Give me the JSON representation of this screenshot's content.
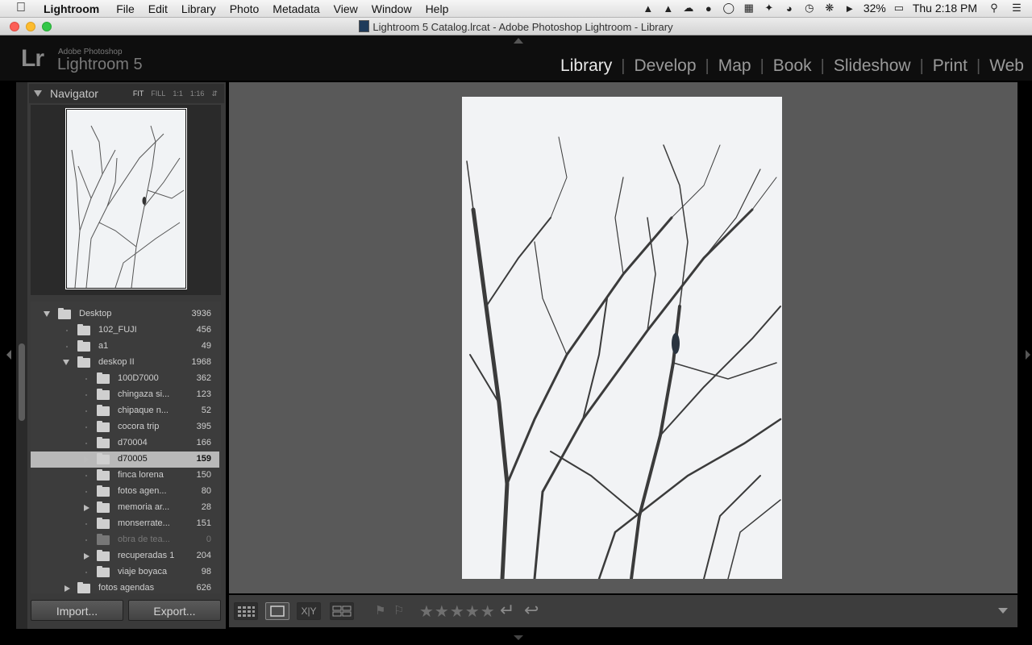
{
  "menubar": {
    "apple": "",
    "items": [
      "Lightroom",
      "File",
      "Edit",
      "Library",
      "Photo",
      "Metadata",
      "View",
      "Window",
      "Help"
    ],
    "battery": "32%",
    "clock": "Thu 2:18 PM"
  },
  "window": {
    "title": "Lightroom 5 Catalog.lrcat - Adobe Photoshop Lightroom - Library"
  },
  "brand": {
    "logo": "Lr",
    "company": "Adobe Photoshop",
    "product": "Lightroom 5"
  },
  "modules": [
    "Library",
    "Develop",
    "Map",
    "Book",
    "Slideshow",
    "Print",
    "Web"
  ],
  "active_module": "Library",
  "navigator": {
    "title": "Navigator",
    "zoom": [
      "FIT",
      "FILL",
      "1:1",
      "1:16"
    ]
  },
  "folders": [
    {
      "name": "Desktop",
      "count": "3936",
      "level": 0,
      "disclosure": "open"
    },
    {
      "name": "102_FUJI",
      "count": "456",
      "level": 1,
      "disclosure": "none"
    },
    {
      "name": "a1",
      "count": "49",
      "level": 1,
      "disclosure": "none"
    },
    {
      "name": "deskop II",
      "count": "1968",
      "level": 1,
      "disclosure": "open"
    },
    {
      "name": "100D7000",
      "count": "362",
      "level": 2,
      "disclosure": "none"
    },
    {
      "name": "chingaza si...",
      "count": "123",
      "level": 2,
      "disclosure": "none"
    },
    {
      "name": "chipaque n...",
      "count": "52",
      "level": 2,
      "disclosure": "none"
    },
    {
      "name": "cocora trip",
      "count": "395",
      "level": 2,
      "disclosure": "none"
    },
    {
      "name": "d70004",
      "count": "166",
      "level": 2,
      "disclosure": "none"
    },
    {
      "name": "d70005",
      "count": "159",
      "level": 2,
      "disclosure": "closed",
      "selected": true
    },
    {
      "name": "finca lorena",
      "count": "150",
      "level": 2,
      "disclosure": "none"
    },
    {
      "name": "fotos agen...",
      "count": "80",
      "level": 2,
      "disclosure": "none"
    },
    {
      "name": "memoria ar...",
      "count": "28",
      "level": 2,
      "disclosure": "closed"
    },
    {
      "name": "monserrate...",
      "count": "151",
      "level": 2,
      "disclosure": "none"
    },
    {
      "name": "obra de tea...",
      "count": "0",
      "level": 2,
      "disclosure": "none",
      "dim": true
    },
    {
      "name": "recuperadas 1",
      "count": "204",
      "level": 2,
      "disclosure": "closed"
    },
    {
      "name": "viaje boyaca",
      "count": "98",
      "level": 2,
      "disclosure": "none"
    },
    {
      "name": "fotos agendas",
      "count": "626",
      "level": 1,
      "disclosure": "closed"
    }
  ],
  "buttons": {
    "import": "Import...",
    "export": "Export..."
  },
  "toolbar": {
    "compare_label": "X|Y",
    "rating_stars": "★★★★★"
  }
}
